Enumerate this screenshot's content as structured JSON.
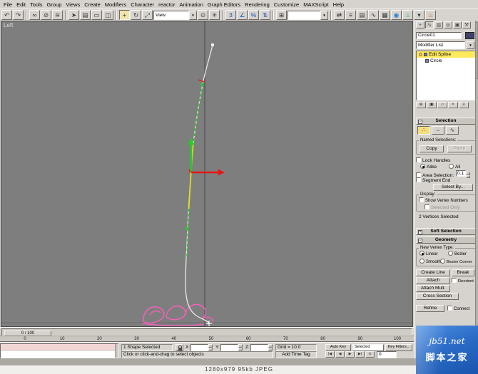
{
  "colors": {
    "viewport_bg": "#7e7e7e",
    "spline": "#e8e8e8",
    "soft_green": "#35c435",
    "soft_yellow": "#e0e01e",
    "gizmo_green": "#21d121",
    "gizmo_red": "#e81515",
    "shape_pink": "#ff5fbe",
    "stack_highlight": "#ffe95c",
    "watermark_blue": "#2b6cc8"
  },
  "icons": {
    "minus": "-",
    "plus": "+",
    "chevron_down": "▼"
  },
  "menu": {
    "items": [
      "File",
      "Edit",
      "Tools",
      "Group",
      "Views",
      "Create",
      "Modifiers",
      "Character",
      "reactor",
      "Animation",
      "Graph Editors",
      "Rendering",
      "Customize",
      "MAXScript",
      "Help"
    ]
  },
  "toolbar": {
    "items": [
      {
        "t": "icon",
        "name": "undo-icon",
        "glyph": "↶"
      },
      {
        "t": "icon",
        "name": "redo-icon",
        "glyph": "↷"
      },
      {
        "t": "sep"
      },
      {
        "t": "icon",
        "name": "select-and-link-icon",
        "glyph": "∞"
      },
      {
        "t": "icon",
        "name": "unlink-selection-icon",
        "glyph": "⊘"
      },
      {
        "t": "icon",
        "name": "bind-to-space-warp-icon",
        "glyph": "≋"
      },
      {
        "t": "sep"
      },
      {
        "t": "icon",
        "name": "select-object-icon",
        "glyph": "➤"
      },
      {
        "t": "icon",
        "name": "select-by-name-icon",
        "glyph": "▤"
      },
      {
        "t": "icon",
        "name": "rectangular-selection-region-icon",
        "glyph": "▭"
      },
      {
        "t": "icon",
        "name": "window-crossing-icon",
        "glyph": "◫"
      },
      {
        "t": "sep"
      },
      {
        "t": "icon",
        "name": "select-and-move-icon",
        "glyph": "+",
        "active": true
      },
      {
        "t": "icon",
        "name": "select-and-rotate-icon",
        "glyph": "↻"
      },
      {
        "t": "icon",
        "name": "select-and-uniform-scale-icon",
        "glyph": "⤢"
      },
      {
        "t": "combo",
        "name": "reference-coordinate-system-combo",
        "value": "View",
        "width": 50
      },
      {
        "t": "icon",
        "name": "use-pivot-point-center-icon",
        "glyph": "⊙"
      },
      {
        "t": "icon",
        "name": "select-and-manipulate-icon",
        "glyph": "✳"
      },
      {
        "t": "sep"
      },
      {
        "t": "icon",
        "name": "snap-toggle-icon",
        "glyph": "3",
        "color": "#1857c2"
      },
      {
        "t": "icon",
        "name": "angle-snap-toggle-icon",
        "glyph": "∠",
        "color": "#1857c2"
      },
      {
        "t": "icon",
        "name": "percent-snap-toggle-icon",
        "glyph": "%",
        "color": "#1857c2"
      },
      {
        "t": "icon",
        "name": "spinner-snap-toggle-icon",
        "glyph": "⇅",
        "color": "#1857c2"
      },
      {
        "t": "sep"
      },
      {
        "t": "icon",
        "name": "edit-named-selection-sets-icon",
        "glyph": "⊞"
      },
      {
        "t": "combo",
        "name": "named-selection-sets-combo",
        "value": "",
        "width": 46
      },
      {
        "t": "sep"
      },
      {
        "t": "icon",
        "name": "mirror-icon",
        "glyph": "⇄"
      },
      {
        "t": "icon",
        "name": "align-icon",
        "glyph": "≡"
      },
      {
        "t": "icon",
        "name": "layer-manager-icon",
        "glyph": "▤"
      },
      {
        "t": "icon",
        "name": "curve-editor-icon",
        "glyph": "∿"
      },
      {
        "t": "icon",
        "name": "schematic-view-icon",
        "glyph": "▦"
      },
      {
        "t": "icon",
        "name": "material-editor-icon",
        "glyph": "◉",
        "color": "#1a7ad4"
      },
      {
        "t": "icon",
        "name": "render-scene-icon",
        "glyph": "♨",
        "color": "#2a9d4e"
      },
      {
        "t": "icon",
        "name": "render-type-icon",
        "glyph": "▾"
      },
      {
        "t": "icon",
        "name": "quick-render-icon",
        "glyph": "♨",
        "color": "#c2641a"
      }
    ]
  },
  "viewport": {
    "label": "Left"
  },
  "panel": {
    "tabs": [
      {
        "name": "tab-create",
        "glyph": "+"
      },
      {
        "name": "tab-modify",
        "glyph": "∿",
        "active": true
      },
      {
        "name": "tab-hierarchy",
        "glyph": "▥"
      },
      {
        "name": "tab-motion",
        "glyph": "◎"
      },
      {
        "name": "tab-display",
        "glyph": "▣"
      },
      {
        "name": "tab-utilities",
        "glyph": "⚒"
      }
    ],
    "object_name": "Circle01",
    "modifier_list_label": "Modifier List",
    "stack_rows": [
      {
        "label": "Edit Spline",
        "selected": true,
        "bulb": true
      },
      {
        "label": "Circle",
        "selected": false,
        "bulb": false
      }
    ],
    "stack_buttons": [
      {
        "name": "pin-stack-icon",
        "glyph": "⊕"
      },
      {
        "name": "show-end-result-icon",
        "glyph": "▣"
      },
      {
        "name": "make-unique-icon",
        "glyph": "▱"
      },
      {
        "name": "remove-modifier-icon",
        "glyph": "×"
      },
      {
        "name": "configure-modifier-sets-icon",
        "glyph": "≡"
      }
    ],
    "subobject_buttons": [
      {
        "name": "vertex-mode-button",
        "glyph": "∴",
        "active": true,
        "color": "#c22020"
      },
      {
        "name": "segment-mode-button",
        "glyph": "⌣",
        "color": "#333333"
      },
      {
        "name": "spline-mode-button",
        "glyph": "∿",
        "color": "#333333"
      }
    ],
    "selection": {
      "title": "Selection",
      "named_selections_label": "Named Selections:",
      "copy_label": "Copy",
      "paste_label": "Paste",
      "lock_handles_label": "Lock Handles",
      "alike_label": "Alike",
      "all_label": "All",
      "area_selection_label": "Area Selection:",
      "area_value": "0.1",
      "segment_end_label": "Segment End",
      "select_by_label": "Select By...",
      "display_label": "Display:",
      "show_vertex_numbers_label": "Show Vertex Numbers",
      "selected_only_label": "Selected Only",
      "status": "2 Vertices Selected"
    },
    "soft_selection_title": "Soft Selection",
    "geometry": {
      "title": "Geometry",
      "new_vertex_type_label": "New Vertex Type:",
      "linear_label": "Linear",
      "bezier_label": "Bezier",
      "smooth_label": "Smooth",
      "bezier_corner_label": "Bezier Corner",
      "create_line_label": "Create Line",
      "break_label": "Break",
      "attach_label": "Attach",
      "reorient_label": "Reorient",
      "attach_mult_label": "Attach Mult.",
      "cross_section_label": "Cross Section",
      "refine_label": "Refine",
      "connect_label": "Connect"
    }
  },
  "timeline": {
    "slider_label": "0 / 100"
  },
  "trackbar": {
    "ticks": [
      "0",
      "10",
      "20",
      "30",
      "40",
      "50",
      "60",
      "70",
      "80",
      "90",
      "100"
    ]
  },
  "status": {
    "selection_status": "1 Shape Selected",
    "x_label": "X:",
    "y_label": "Y:",
    "z_label": "Z:",
    "x_value": "",
    "y_value": "",
    "z_value": "",
    "grid_label": "Grid = 10.0",
    "prompt": "Click or click-and-drag to select objects",
    "add_time_tag_label": "Add Time Tag",
    "auto_key_label": "Auto Key",
    "key_mode_label": "Selected",
    "key_filters_label": "Key Filters...",
    "frame_value": "0",
    "playback": [
      {
        "name": "go-to-start-icon",
        "glyph": "|◀"
      },
      {
        "name": "previous-frame-icon",
        "glyph": "◀"
      },
      {
        "name": "play-animation-icon",
        "glyph": "▶"
      },
      {
        "name": "go-to-end-icon",
        "glyph": "▶|"
      },
      {
        "name": "time-configuration-icon",
        "glyph": "⊙"
      }
    ]
  },
  "caption": {
    "text": "1280x979  95kb  JPEG"
  },
  "watermark": {
    "site": "jb51.net",
    "brand": "脚本之家"
  }
}
